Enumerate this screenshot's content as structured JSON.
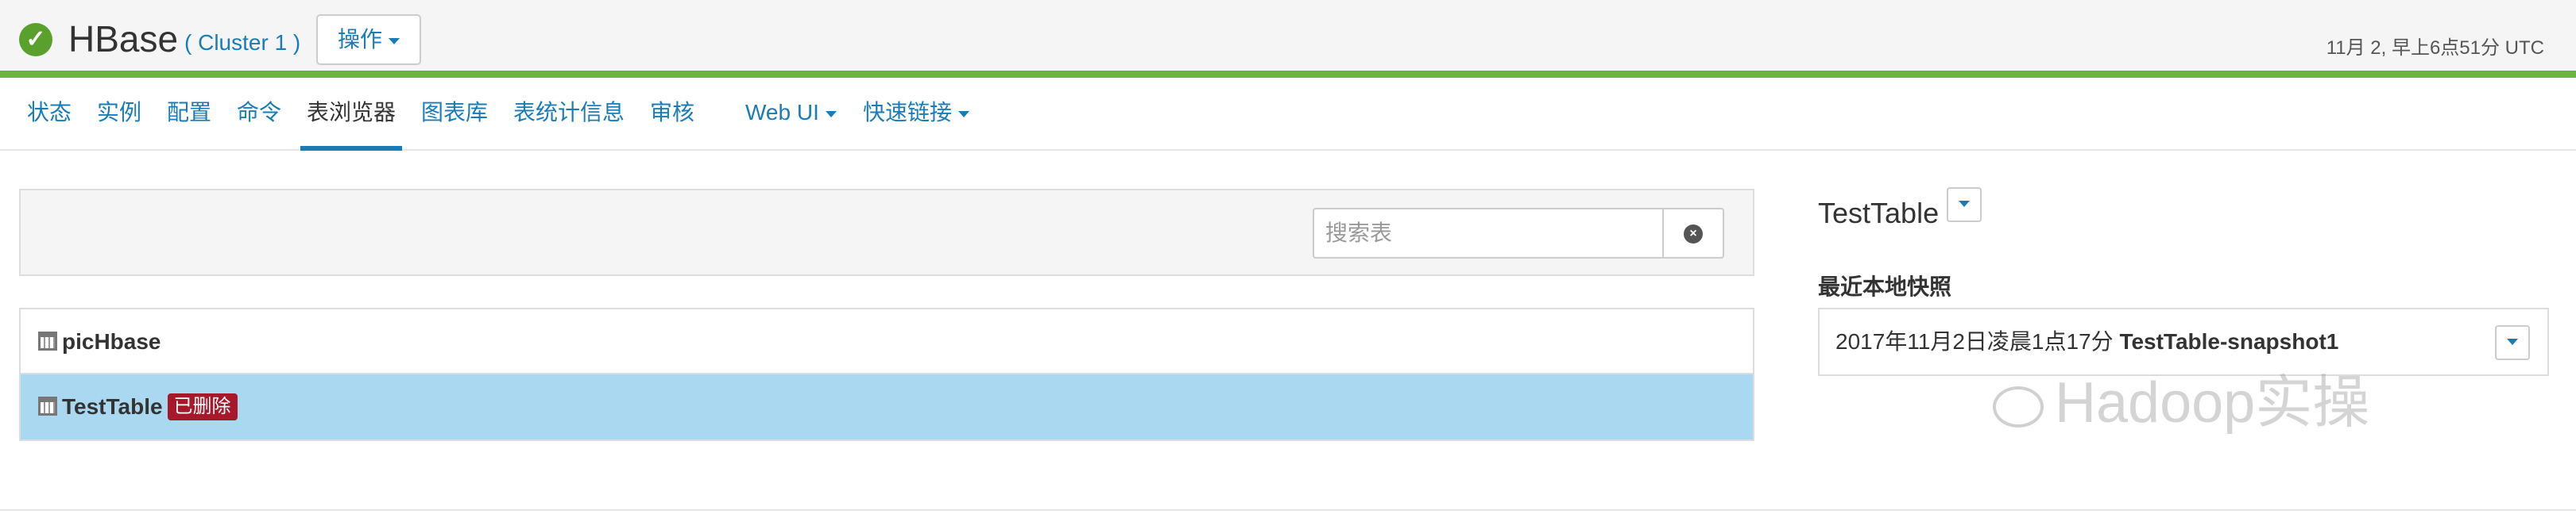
{
  "header": {
    "status_icon": "check-circle-icon",
    "service_name": "HBase",
    "cluster_link": "( Cluster 1 )",
    "actions_label": "操作",
    "timestamp": "11月 2, 早上6点51分 UTC",
    "accent_color": "#6cb33f"
  },
  "nav": {
    "tabs": [
      {
        "label": "状态"
      },
      {
        "label": "实例"
      },
      {
        "label": "配置"
      },
      {
        "label": "命令"
      },
      {
        "label": "表浏览器",
        "active": true
      },
      {
        "label": "图表库"
      },
      {
        "label": "表统计信息"
      },
      {
        "label": "审核"
      },
      {
        "label": "Web UI",
        "dropdown": true
      },
      {
        "label": "快速链接",
        "dropdown": true
      }
    ]
  },
  "search": {
    "placeholder": "搜索表",
    "clear_icon": "clear-circle-icon"
  },
  "tables": [
    {
      "name": "picHbase",
      "icon": "calendar-icon",
      "badge": ""
    },
    {
      "name": "TestTable",
      "icon": "calendar-icon",
      "badge": "已删除",
      "selected": true
    }
  ],
  "detail": {
    "title": "TestTable",
    "snapshots_label": "最近本地快照",
    "snapshot_time": "2017年11月2日凌晨1点17分",
    "snapshot_name": "TestTable-snapshot1"
  },
  "watermark": {
    "text": "Hadoop实操",
    "icon": "wechat-icon"
  }
}
